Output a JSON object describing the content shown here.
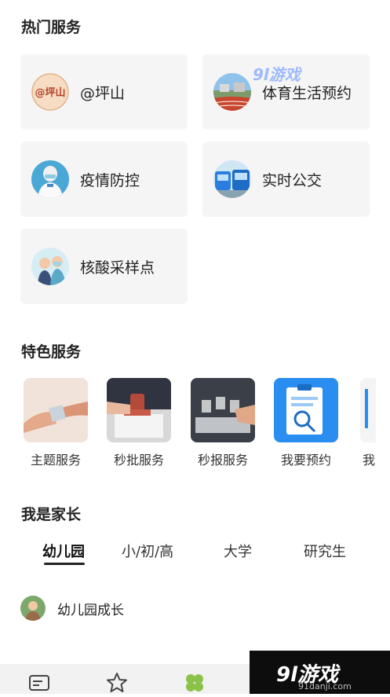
{
  "hot_services": {
    "title": "热门服务",
    "items": [
      {
        "label": "@坪山",
        "icon": "pingshan-logo-icon"
      },
      {
        "label": "体育生活预约",
        "icon": "stadium-icon"
      },
      {
        "label": "疫情防控",
        "icon": "medical-worker-icon"
      },
      {
        "label": "实时公交",
        "icon": "bus-icon"
      },
      {
        "label": "核酸采样点",
        "icon": "nucleic-test-icon"
      }
    ],
    "logo_text": "@坪山"
  },
  "featured": {
    "title": "特色服务",
    "items": [
      {
        "label": "主题服务"
      },
      {
        "label": "秒批服务"
      },
      {
        "label": "秒报服务"
      },
      {
        "label": "我要预约"
      },
      {
        "label": "我"
      }
    ]
  },
  "parent": {
    "title": "我是家长",
    "tabs": [
      "幼儿园",
      "小/初/高",
      "大学",
      "研究生"
    ],
    "active_tab": "幼儿园",
    "list": [
      {
        "label": "幼儿园成长"
      }
    ]
  },
  "watermark": {
    "text": "9l游戏",
    "url": "91danji.com",
    "top_logo": "9l游戏"
  },
  "colors": {
    "accent": "#8bc34a",
    "card_bg": "#f5f5f5",
    "bus_blue": "#2b7de0"
  }
}
